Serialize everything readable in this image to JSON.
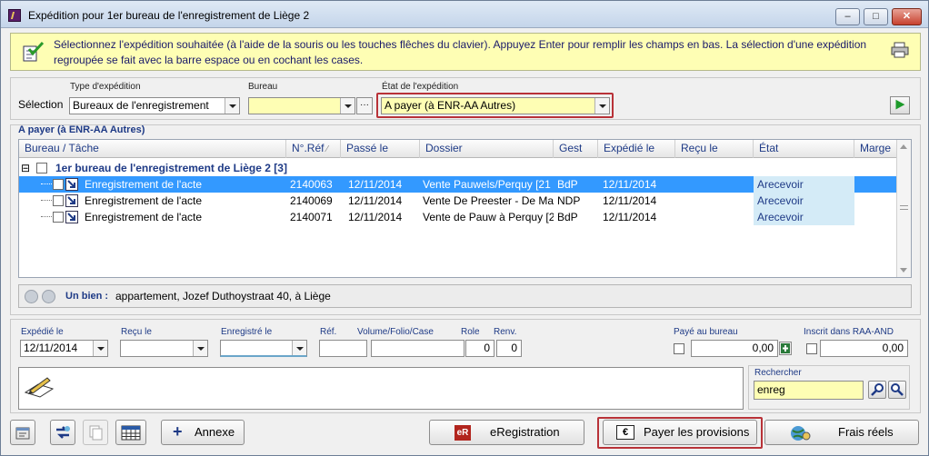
{
  "window": {
    "title": "Expédition pour 1er bureau de l'enregistrement de Liège 2",
    "minimize": "–",
    "maximize": "□",
    "close": "✕"
  },
  "info": {
    "message": "Sélectionnez l'expédition souhaitée (à l'aide de la souris ou les touches flêches du clavier). Appuyez Enter pour remplir les champs en bas. La sélection d'une expédition regroupée se fait avec la barre espace ou en cochant les cases."
  },
  "selection": {
    "label": "Sélection",
    "type_label": "Type d'expédition",
    "type_value": "Bureaux de l'enregistrement",
    "bureau_label": "Bureau",
    "bureau_value": "",
    "bureau_ellipsis": "···",
    "etat_label": "État de l'expédition",
    "etat_value": "A payer (à ENR-AA Autres)"
  },
  "grid": {
    "title": "A payer (à ENR-AA Autres)",
    "columns": [
      "Bureau / Tâche",
      "N°.Réf",
      "Passé le",
      "Dossier",
      "Gest",
      "Expédié le",
      "Reçu le",
      "État",
      "Marge"
    ],
    "group": {
      "expander": "⊟",
      "label": "1er bureau de l'enregistrement de Liège 2 [3]"
    },
    "rows": [
      {
        "task": "Enregistrement de l'acte",
        "ref": "2140063",
        "passe": "12/11/2014",
        "dossier": "Vente Pauwels/Perquy [21",
        "gest": "BdP",
        "expedie": "12/11/2014",
        "recu": "",
        "etat": "Arecevoir",
        "marge": ""
      },
      {
        "task": "Enregistrement de l'acte",
        "ref": "2140069",
        "passe": "12/11/2014",
        "dossier": "Vente De Preester - De Ma",
        "gest": "NDP",
        "expedie": "12/11/2014",
        "recu": "",
        "etat": "Arecevoir",
        "marge": ""
      },
      {
        "task": "Enregistrement de l'acte",
        "ref": "2140071",
        "passe": "12/11/2014",
        "dossier": "Vente de Pauw à Perquy [2",
        "gest": "BdP",
        "expedie": "12/11/2014",
        "recu": "",
        "etat": "Arecevoir",
        "marge": ""
      }
    ]
  },
  "status": {
    "label": "Un bien :",
    "value": "appartement, Jozef Duthoystraat 40, à Liège"
  },
  "form": {
    "expedie_label": "Expédié le",
    "expedie_value": "12/11/2014",
    "recu_label": "Reçu le",
    "recu_value": "",
    "enregistre_label": "Enregistré le",
    "enregistre_value": "",
    "ref_label": "Réf.",
    "ref_value": "",
    "volume_label": "Volume/Folio/Case",
    "volume_value": "",
    "role_label": "Role",
    "role_value": "0",
    "renv_label": "Renv.",
    "renv_value": "0",
    "paye_label": "Payé au bureau",
    "paye_value": "0,00",
    "inscrit_label": "Inscrit dans RAA-AND",
    "inscrit_value": "0,00",
    "search_label": "Rechercher",
    "search_value": "enreg"
  },
  "toolbar": {
    "annexe_label": "Annexe",
    "annexe_plus": "+",
    "eregistration_badge": "eR",
    "eregistration_label": "eRegistration",
    "payer_badge": "€",
    "payer_label": "Payer les provisions",
    "frais_label": "Frais réels"
  },
  "colors": {
    "accent_blue": "#1e3a86",
    "selection_blue": "#3399ff",
    "info_yellow": "#fefeb4",
    "highlight_red": "#b83238"
  }
}
